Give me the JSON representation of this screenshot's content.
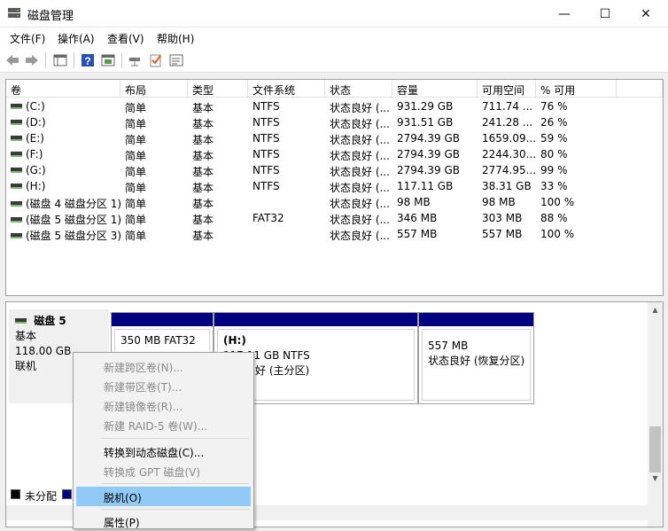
{
  "window": {
    "title": "磁盘管理",
    "minimize_glyph": "—",
    "maximize_glyph": "☐",
    "close_glyph": "✕"
  },
  "menu": [
    "文件(F)",
    "操作(A)",
    "查看(V)",
    "帮助(H)"
  ],
  "toolbar_icons": [
    "back-icon",
    "forward-icon",
    "console-tree-icon",
    "help-icon",
    "action-pane-icon",
    "connect-icon",
    "check-icon",
    "properties-icon"
  ],
  "volume_table": {
    "columns": [
      "卷",
      "布局",
      "类型",
      "文件系统",
      "状态",
      "容量",
      "可用空间",
      "% 可用"
    ],
    "rows": [
      [
        "(C:)",
        "简单",
        "基本",
        "NTFS",
        "状态良好 (...",
        "931.29 GB",
        "711.74 ...",
        "76 %"
      ],
      [
        "(D:)",
        "简单",
        "基本",
        "NTFS",
        "状态良好 (...",
        "931.51 GB",
        "241.28 ...",
        "26 %"
      ],
      [
        "(E:)",
        "简单",
        "基本",
        "NTFS",
        "状态良好 (...",
        "2794.39 GB",
        "1659.09...",
        "59 %"
      ],
      [
        "(F:)",
        "简单",
        "基本",
        "NTFS",
        "状态良好 (...",
        "2794.39 GB",
        "2244.30...",
        "80 %"
      ],
      [
        "(G:)",
        "简单",
        "基本",
        "NTFS",
        "状态良好 (...",
        "2794.39 GB",
        "2774.95...",
        "99 %"
      ],
      [
        "(H:)",
        "简单",
        "基本",
        "NTFS",
        "状态良好 (...",
        "117.11 GB",
        "38.31 GB",
        "33 %"
      ],
      [
        "(磁盘 4 磁盘分区 1)",
        "简单",
        "基本",
        "",
        "状态良好 (...",
        "98 MB",
        "98 MB",
        "100 %"
      ],
      [
        "(磁盘 5 磁盘分区 1)",
        "简单",
        "基本",
        "FAT32",
        "状态良好 (...",
        "346 MB",
        "303 MB",
        "88 %"
      ],
      [
        "(磁盘 5 磁盘分区 3)",
        "简单",
        "基本",
        "",
        "状态良好 (...",
        "557 MB",
        "557 MB",
        "100 %"
      ]
    ]
  },
  "disk": {
    "name": "磁盘 5",
    "type": "基本",
    "size": "118.00 GB",
    "status": "联机",
    "partitions": [
      {
        "line1": "350 MB FAT32",
        "line2": ""
      },
      {
        "line1": "(H:)",
        "line2": "117.11 GB NTFS",
        "line3": "状态良好 (主分区)"
      },
      {
        "line1": "557 MB",
        "line2": "状态良好 (恢复分区)"
      }
    ]
  },
  "legend": [
    {
      "label": "未分配",
      "color": "#000000"
    },
    {
      "label": "",
      "color": "#000080"
    }
  ],
  "context_menu": [
    {
      "label": "新建跨区卷(N)...",
      "enabled": false
    },
    {
      "label": "新建带区卷(T)...",
      "enabled": false
    },
    {
      "label": "新建镜像卷(R)...",
      "enabled": false
    },
    {
      "label": "新建 RAID-5 卷(W)...",
      "enabled": false
    },
    {
      "label": "转换到动态磁盘(C)...",
      "enabled": true
    },
    {
      "label": "转换成 GPT 磁盘(V)",
      "enabled": false
    },
    {
      "label": "脱机(O)",
      "enabled": true,
      "highlighted": true
    },
    {
      "label": "属性(P)",
      "enabled": true
    }
  ]
}
